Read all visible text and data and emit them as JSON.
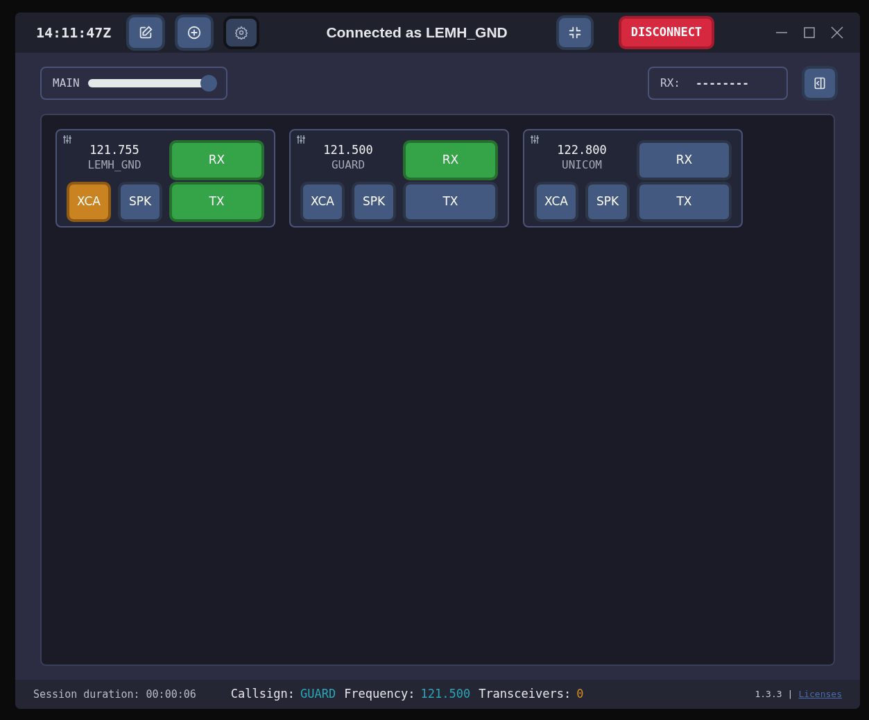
{
  "clock": "14:11:47Z",
  "title": "Connected as LEMH_GND",
  "disconnect_button": "DISCONNECT",
  "volume": {
    "label": "MAIN",
    "level": 0.95
  },
  "rx_display": {
    "label": "RX:",
    "value": "--------"
  },
  "stations": [
    {
      "frequency": "121.755",
      "callsign": "LEMH_GND",
      "buttons": [
        {
          "kind": "rx",
          "label": "RX",
          "on": true
        },
        {
          "kind": "xca",
          "label": "XCA",
          "on": true
        },
        {
          "kind": "spk",
          "label": "SPK",
          "on": false
        },
        {
          "kind": "tx",
          "label": "TX",
          "on": true
        }
      ]
    },
    {
      "frequency": "121.500",
      "callsign": "GUARD",
      "buttons": [
        {
          "kind": "rx",
          "label": "RX",
          "on": true
        },
        {
          "kind": "xca",
          "label": "XCA",
          "on": false
        },
        {
          "kind": "spk",
          "label": "SPK",
          "on": false
        },
        {
          "kind": "tx",
          "label": "TX",
          "on": false
        }
      ]
    },
    {
      "frequency": "122.800",
      "callsign": "UNICOM",
      "buttons": [
        {
          "kind": "rx",
          "label": "RX",
          "on": false
        },
        {
          "kind": "xca",
          "label": "XCA",
          "on": false
        },
        {
          "kind": "spk",
          "label": "SPK",
          "on": false
        },
        {
          "kind": "tx",
          "label": "TX",
          "on": false
        }
      ]
    }
  ],
  "status_bar": {
    "session": "Session duration: 00:00:06",
    "callsign_label": "Callsign:",
    "callsign": "GUARD",
    "frequency_label": "Frequency:",
    "frequency": "121.500",
    "transceivers_label": "Transceivers:",
    "transceivers": "0",
    "version": "1.3.3",
    "separator": "|",
    "licenses_link": "Licenses"
  }
}
